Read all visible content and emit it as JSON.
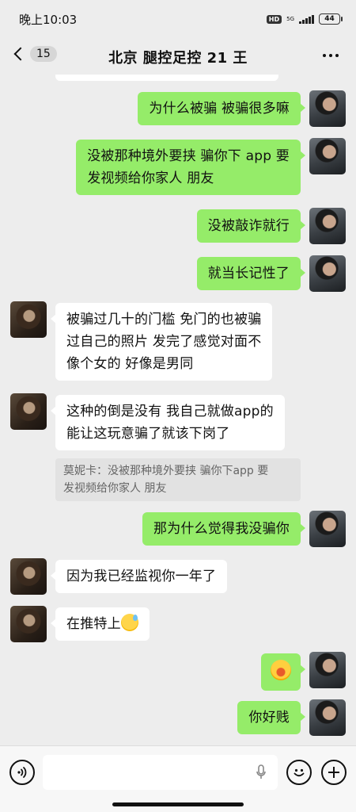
{
  "status": {
    "time": "晚上10:03",
    "hd": "HD",
    "network": "5G",
    "battery": "44"
  },
  "nav": {
    "unread_count": "15",
    "title": "北京 腿控足控 21 王"
  },
  "messages": [
    {
      "side": "self",
      "text": "为什么被骗 被骗很多嘛"
    },
    {
      "side": "self",
      "line1": "没被那种境外要挟 骗你下 app 要",
      "line2": "发视频给你家人 朋友"
    },
    {
      "side": "self",
      "text": "没被敲诈就行"
    },
    {
      "side": "self",
      "text": "就当长记性了"
    },
    {
      "side": "other",
      "line1": "被骗过几十的门槛 免门的也被骗",
      "line2": "过自己的照片 发完了感觉对面不",
      "line3": "像个女的 好像是男同"
    },
    {
      "side": "other",
      "line1": "这种的倒是没有 我自己就做app的",
      "line2": "能让这玩意骗了就该下岗了",
      "quote_line1": "莫妮卡：没被那种境外要挟 骗你下app 要",
      "quote_line2": "发视频给你家人 朋友"
    },
    {
      "side": "self",
      "text": "那为什么觉得我没骗你"
    },
    {
      "side": "other",
      "text": "因为我已经监视你一年了"
    },
    {
      "side": "other",
      "text": "在推特上",
      "emoji": "sweat-smile-emoji"
    },
    {
      "side": "self",
      "emoji": "hot-face-emoji"
    },
    {
      "side": "self",
      "text": "你好贱"
    }
  ],
  "input": {
    "placeholder": ""
  },
  "colors": {
    "self_bubble": "#95ec69",
    "other_bubble": "#ffffff",
    "background": "#ededed"
  }
}
